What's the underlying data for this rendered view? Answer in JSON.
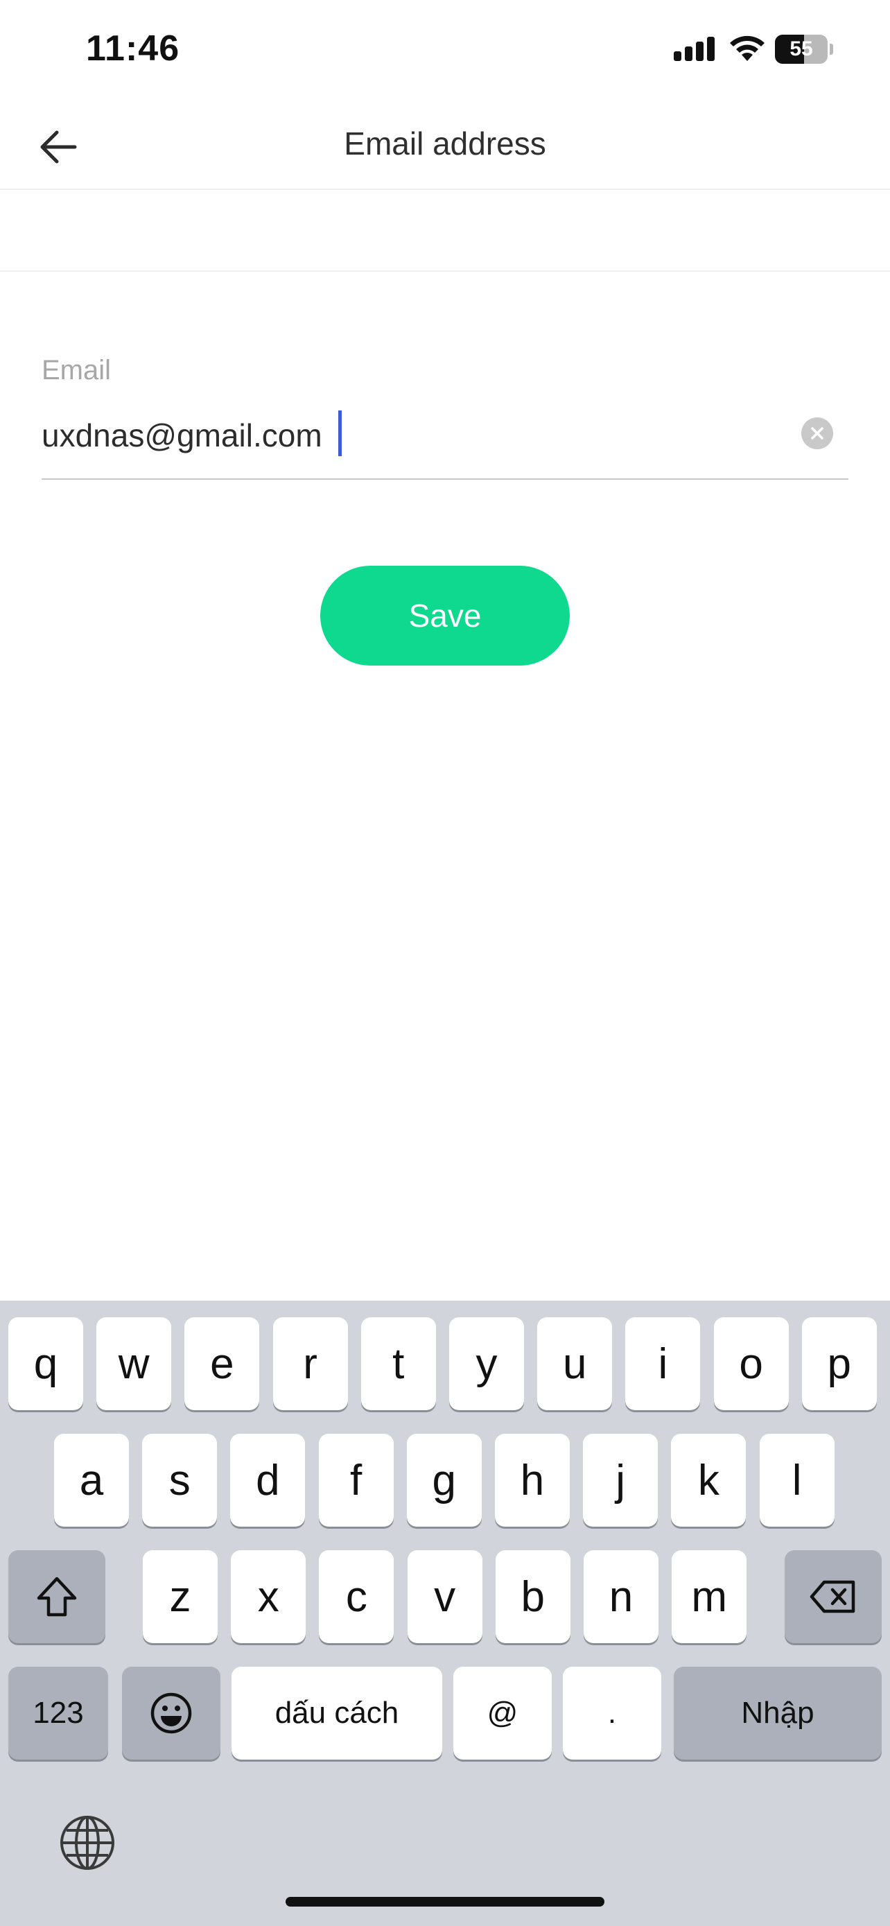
{
  "status_bar": {
    "time": "11:46",
    "battery_level": "55",
    "battery_fraction": 0.55
  },
  "header": {
    "title": "Email address",
    "back_icon": "arrow-left-icon"
  },
  "form": {
    "email_label": "Email",
    "email_value": "uxdnas@gmail.com",
    "clear_icon": "clear-circle-icon"
  },
  "save_button": {
    "label": "Save",
    "color": "#0fd98e"
  },
  "keyboard": {
    "row1": [
      "q",
      "w",
      "e",
      "r",
      "t",
      "y",
      "u",
      "i",
      "o",
      "p"
    ],
    "row2": [
      "a",
      "s",
      "d",
      "f",
      "g",
      "h",
      "j",
      "k",
      "l"
    ],
    "row3": [
      "z",
      "x",
      "c",
      "v",
      "b",
      "n",
      "m"
    ],
    "numbers_key": "123",
    "space_key": "dấu cách",
    "at_key": "@",
    "dot_key": ".",
    "return_key": "Nhập"
  },
  "colors": {
    "accent": "#0fd98e",
    "caret": "#3f5bd8",
    "keyboard_bg": "#d1d4db"
  }
}
